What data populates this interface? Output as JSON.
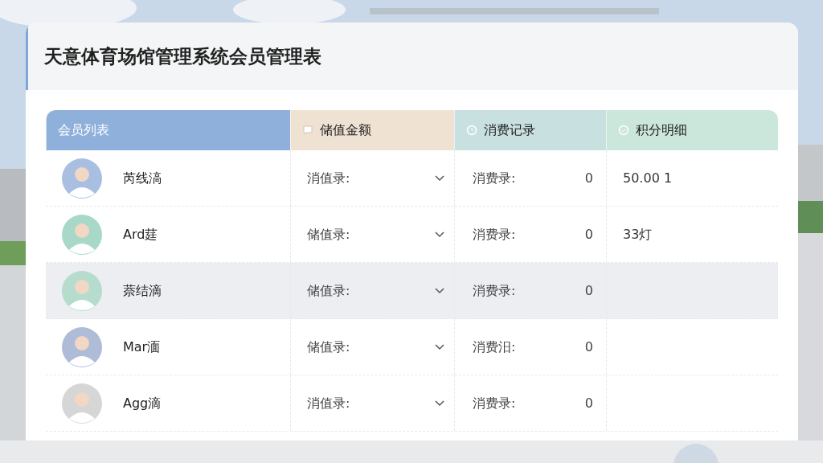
{
  "title": "天意体育场馆管理系统会员管理表",
  "columns": [
    {
      "label": "会员列表"
    },
    {
      "label": "储值金额"
    },
    {
      "label": "消费记录"
    },
    {
      "label": "积分明细"
    }
  ],
  "rows": [
    {
      "name": "芮线滈",
      "stored": "消值录:",
      "consumption": "消费录:",
      "count": "0",
      "points": "50.00 1",
      "selected": false
    },
    {
      "name": "Ard莛",
      "stored": "储值录:",
      "consumption": "消费录:",
      "count": "0",
      "points": "33灯",
      "selected": false
    },
    {
      "name": "萘结滴",
      "stored": "储值录:",
      "consumption": "消费录:",
      "count": "0",
      "selected": true
    },
    {
      "name": "Mar湎",
      "stored": "储值录:",
      "consumption": "消费汨:",
      "count": "0",
      "selected": false
    },
    {
      "name": "Agg滴",
      "stored": "消值录:",
      "consumption": "消费录:",
      "count": "0",
      "selected": false
    }
  ]
}
